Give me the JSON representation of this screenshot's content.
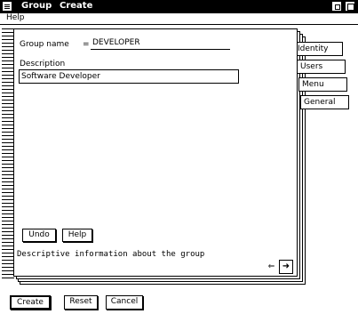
{
  "window": {
    "title_items": [
      "Group",
      "Create"
    ]
  },
  "menu": {
    "help_label": "Help"
  },
  "form": {
    "group_name_label": "Group name",
    "group_name_value": "DEVELOPER",
    "description_label": "Description",
    "description_value": "Software Developer"
  },
  "tabs": [
    {
      "label": "Identity"
    },
    {
      "label": "Users"
    },
    {
      "label": "Menu"
    },
    {
      "label": "General"
    }
  ],
  "page_buttons": {
    "undo_label": "Undo",
    "help_label": "Help"
  },
  "status_text": "Descriptive information about the group",
  "footer": {
    "create_label": "Create",
    "reset_label": "Reset",
    "cancel_label": "Cancel"
  },
  "colors": {
    "foreground": "#000000",
    "background": "#ffffff"
  }
}
